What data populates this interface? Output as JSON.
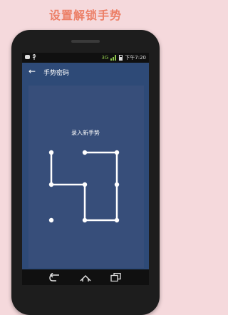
{
  "promo": {
    "title": "设置解锁手势"
  },
  "status_bar": {
    "time": "下午7:20",
    "network": "3G"
  },
  "app_bar": {
    "title": "手势密码"
  },
  "pattern": {
    "prompt": "录入新手势",
    "grid": "3x3",
    "sequence": [
      1,
      4,
      5,
      8,
      9,
      6,
      3,
      2
    ],
    "dot_color": "#ffffff",
    "line_color": "#ffffff"
  },
  "nav": {
    "buttons": [
      "back",
      "home",
      "recents"
    ]
  }
}
